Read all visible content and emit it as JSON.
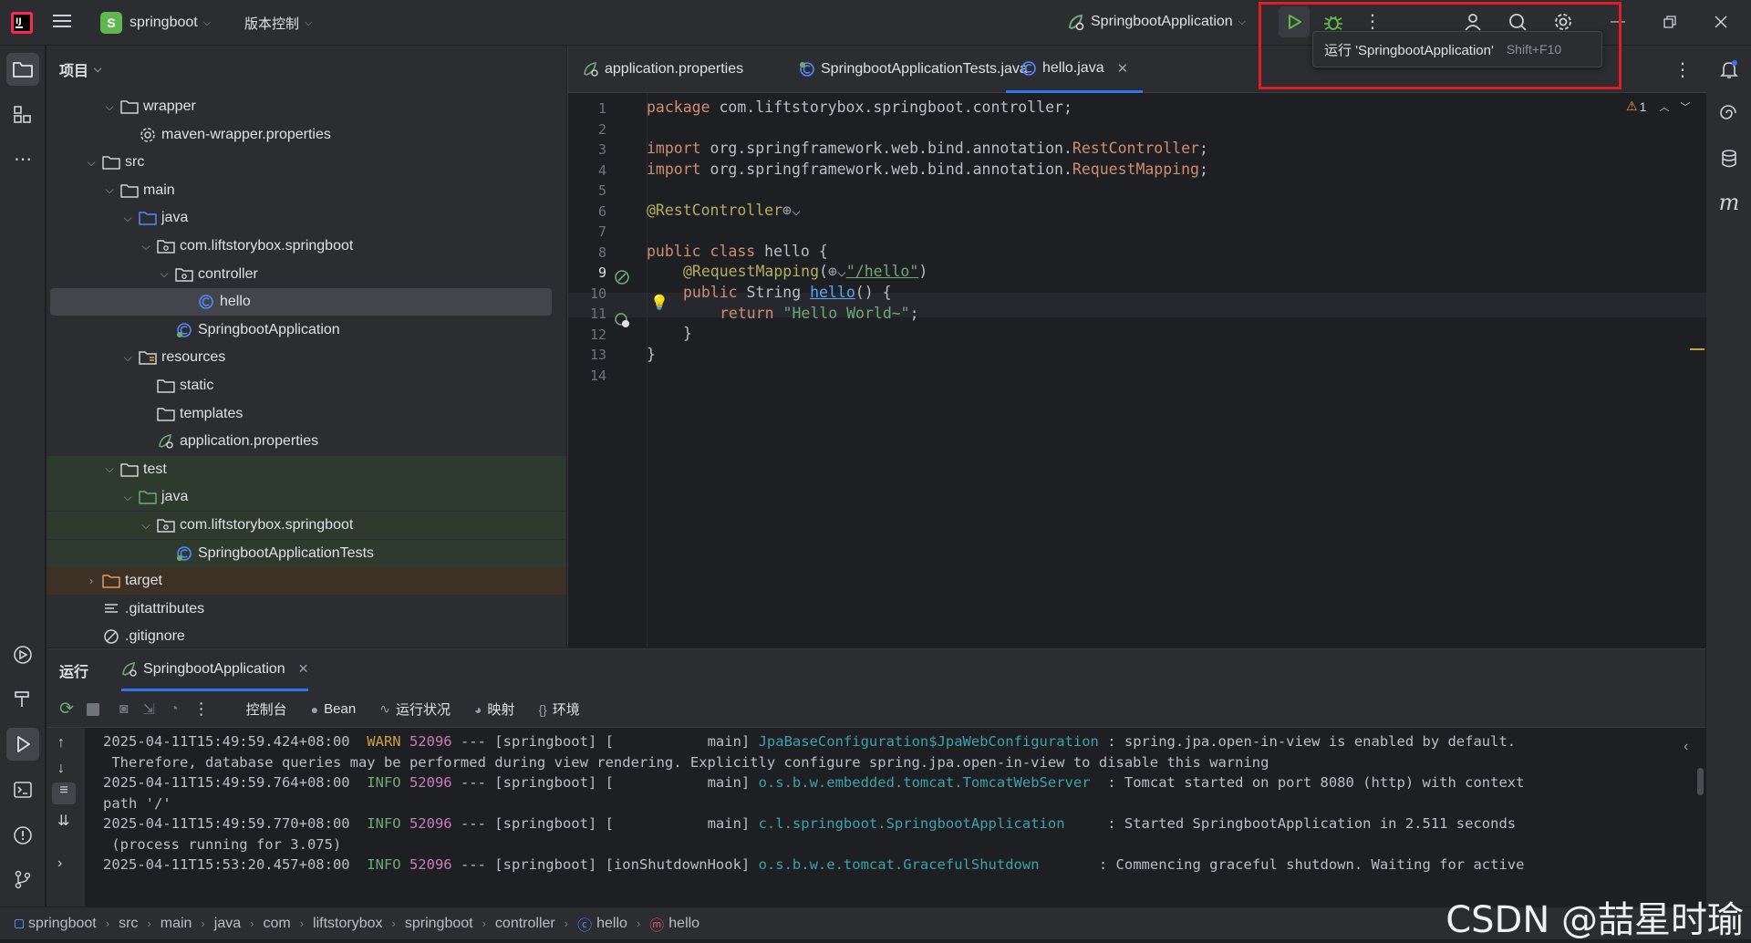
{
  "titlebar": {
    "project_letter": "S",
    "project_name": "springboot",
    "vcs_label": "版本控制",
    "run_config": "SpringbootApplication",
    "tooltip_text": "运行 'SpringbootApplication'",
    "tooltip_shortcut": "Shift+F10"
  },
  "project_panel": {
    "title": "项目",
    "rows": [
      {
        "label": "wrapper",
        "type": "folder"
      },
      {
        "label": "maven-wrapper.properties",
        "type": "settings-file"
      },
      {
        "label": "src",
        "type": "folder"
      },
      {
        "label": "main",
        "type": "folder"
      },
      {
        "label": "java",
        "type": "source-folder"
      },
      {
        "label": "com.liftstorybox.springboot",
        "type": "package"
      },
      {
        "label": "controller",
        "type": "package"
      },
      {
        "label": "hello",
        "type": "class"
      },
      {
        "label": "SpringbootApplication",
        "type": "spring-class"
      },
      {
        "label": "resources",
        "type": "resources-folder"
      },
      {
        "label": "static",
        "type": "folder"
      },
      {
        "label": "templates",
        "type": "folder"
      },
      {
        "label": "application.properties",
        "type": "spring-properties"
      },
      {
        "label": "test",
        "type": "folder"
      },
      {
        "label": "java",
        "type": "test-source-folder"
      },
      {
        "label": "com.liftstorybox.springboot",
        "type": "package"
      },
      {
        "label": "SpringbootApplicationTests",
        "type": "spring-class"
      },
      {
        "label": "target",
        "type": "excluded-folder"
      },
      {
        "label": ".gitattributes",
        "type": "text-file"
      },
      {
        "label": ".gitignore",
        "type": "ignore-file"
      }
    ]
  },
  "editor": {
    "tabs": [
      {
        "label": "application.properties"
      },
      {
        "label": "SpringbootApplicationTests.java"
      },
      {
        "label": "hello.java",
        "active": true
      }
    ],
    "warning_count": "1",
    "line_numbers": [
      "1",
      "2",
      "3",
      "4",
      "5",
      "6",
      "7",
      "8",
      "9",
      "10",
      "11",
      "12",
      "13",
      "14"
    ],
    "code": {
      "l1_kw": "package",
      "l1_rest": " com.liftstorybox.springboot.controller;",
      "l3_kw": "import",
      "l3_pkg": " org.springframework.web.bind.annotation.",
      "l3_cls": "RestController",
      "l3_end": ";",
      "l4_kw": "import",
      "l4_pkg": " org.springframework.web.bind.annotation.",
      "l4_cls": "RequestMapping",
      "l4_end": ";",
      "l6_ann": "@RestController",
      "l8_kw": "public class",
      "l8_rest": " hello {",
      "l9_ann": "@RequestMapping",
      "l9_open": "(",
      "l9_str": "\"/hello\"",
      "l9_close": ")",
      "l10_kw": "public",
      "l10_type": " String ",
      "l10_fn": "hello",
      "l10_rest": "() {",
      "l11_kw": "return",
      "l11_str": " \"Hello World~\"",
      "l11_end": ";",
      "l12": "}",
      "l13": "}"
    }
  },
  "run_panel": {
    "title": "运行",
    "config_tab": "SpringbootApplication",
    "tool_tabs": [
      "控制台",
      "Bean",
      "运行状况",
      "映射",
      "环境"
    ],
    "console": [
      {
        "ts": "2025-04-11T15:49:59.424+08:00",
        "level": "WARN",
        "pid": "52096",
        "mid": " --- [springboot] [           main] ",
        "logger": "JpaBaseConfiguration$JpaWebConfiguration",
        "msg": " : spring.jpa.open-in-view is enabled by default."
      },
      {
        "cont": " Therefore, database queries may be performed during view rendering. Explicitly configure spring.jpa.open-in-view to disable this warning"
      },
      {
        "ts": "2025-04-11T15:49:59.764+08:00",
        "level": "INFO",
        "pid": "52096",
        "mid": " --- [springboot] [           main] ",
        "logger": "o.s.b.w.embedded.tomcat.TomcatWebServer",
        "msg": "  : Tomcat started on port 8080 (http) with context"
      },
      {
        "cont": "path '/'"
      },
      {
        "ts": "2025-04-11T15:49:59.770+08:00",
        "level": "INFO",
        "pid": "52096",
        "mid": " --- [springboot] [           main] ",
        "logger": "c.l.springboot.SpringbootApplication",
        "msg": "     : Started SpringbootApplication in 2.511 seconds"
      },
      {
        "cont": " (process running for 3.075)"
      },
      {
        "ts": "2025-04-11T15:53:20.457+08:00",
        "level": "INFO",
        "pid": "52096",
        "mid": " --- [springboot] [ionShutdownHook] ",
        "logger": "o.s.b.w.e.tomcat.GracefulShutdown",
        "msg": "       : Commencing graceful shutdown. Waiting for active"
      }
    ]
  },
  "statusbar": {
    "crumbs": [
      "springboot",
      "src",
      "main",
      "java",
      "com",
      "liftstorybox",
      "springboot",
      "controller",
      "hello",
      "hello"
    ]
  },
  "watermark": "CSDN @喆星时瑜",
  "colors": {
    "accent": "#3574f0",
    "highlight_box": "#e11d23",
    "run_green": "#5fb84f"
  }
}
